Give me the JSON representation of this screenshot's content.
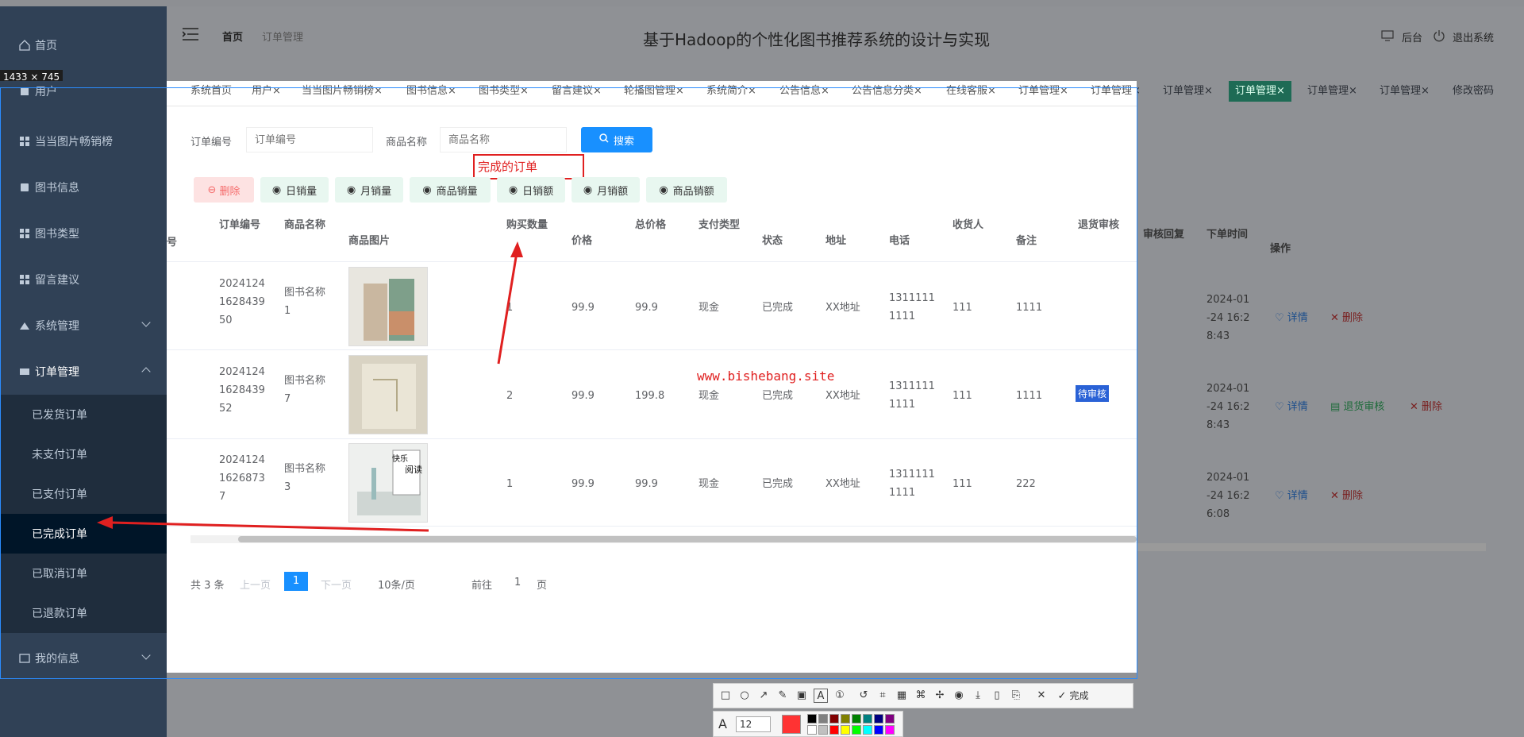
{
  "window": {
    "title": "基于Hadoop的个性化图书推荐系统的设计与实现",
    "size_label": "1433 × 745"
  },
  "header": {
    "breadcrumb": [
      "首页",
      "订单管理"
    ],
    "right_links": [
      "后台",
      "退出系统"
    ]
  },
  "tags": [
    "系统首页",
    "用户",
    "当当图片畅销榜",
    "图书信息",
    "图书类型",
    "留言建议",
    "轮播图管理",
    "系统简介",
    "公告信息",
    "公告信息分类",
    "在线客服",
    "订单管理",
    "订单管理",
    "订单管理",
    "订单管理",
    "订单管理",
    "订单管理",
    "修改密码"
  ],
  "sidebar": {
    "items": [
      {
        "label": "首页"
      },
      {
        "label": "用户"
      },
      {
        "label": "当当图片畅销榜"
      },
      {
        "label": "图书信息"
      },
      {
        "label": "图书类型"
      },
      {
        "label": "留言建议"
      },
      {
        "label": "系统管理"
      },
      {
        "label": "订单管理"
      },
      {
        "label": "我的信息"
      }
    ],
    "sub_items": [
      "已发货订单",
      "未支付订单",
      "已支付订单",
      "已完成订单",
      "已取消订单",
      "已退款订单"
    ]
  },
  "search": {
    "order_no_label": "订单编号",
    "order_no_placeholder": "订单编号",
    "product_label": "商品名称",
    "product_placeholder": "商品名称",
    "search_button": "搜索"
  },
  "annotation_text": "完成的订单",
  "watermark": "www.bishebang.site",
  "action_buttons": [
    "删除",
    "日销量",
    "月销量",
    "商品销量",
    "日销额",
    "月销额",
    "商品销额"
  ],
  "table": {
    "headers": [
      "号",
      "订单编号",
      "商品名称",
      "商品图片",
      "购买数量",
      "价格",
      "总价格",
      "支付类型",
      "状态",
      "地址",
      "电话",
      "收货人",
      "备注",
      "退货审核",
      "审核回复",
      "下单时间",
      "操作"
    ],
    "rows": [
      {
        "order_no": [
          "2024124",
          "1628439",
          "50"
        ],
        "product": [
          "图书名称",
          "1"
        ],
        "qty": "1",
        "price": "99.9",
        "total": "99.9",
        "pay": "现金",
        "status": "已完成",
        "addr": "XX地址",
        "phone": [
          "1311111",
          "1111"
        ],
        "receiver": "111",
        "remark": "1111",
        "refund": "",
        "time": [
          "2024-01",
          "-24 16:2",
          "8:43"
        ],
        "ops": [
          "详情",
          "删除"
        ]
      },
      {
        "order_no": [
          "2024124",
          "1628439",
          "52"
        ],
        "product": [
          "图书名称",
          "7"
        ],
        "qty": "2",
        "price": "99.9",
        "total": "199.8",
        "pay": "现金",
        "status": "已完成",
        "addr": "XX地址",
        "phone": [
          "1311111",
          "1111"
        ],
        "receiver": "111",
        "remark": "1111",
        "refund": "待审核",
        "time": [
          "2024-01",
          "-24 16:2",
          "8:43"
        ],
        "ops": [
          "详情",
          "退货审核",
          "删除"
        ]
      },
      {
        "order_no": [
          "2024124",
          "1626873",
          "7"
        ],
        "product": [
          "图书名称",
          "3"
        ],
        "qty": "1",
        "price": "99.9",
        "total": "99.9",
        "pay": "现金",
        "status": "已完成",
        "addr": "XX地址",
        "phone": [
          "1311111",
          "1111"
        ],
        "receiver": "111",
        "remark": "222",
        "refund": "",
        "time": [
          "2024-01",
          "-24 16:2",
          "6:08"
        ],
        "ops": [
          "详情",
          "删除"
        ]
      }
    ],
    "book3_text": [
      "快乐",
      "阅读"
    ]
  },
  "pagination": {
    "total": "共 3 条",
    "prev": "上一页",
    "current": "1",
    "next": "下一页",
    "page_size": "10条/页",
    "goto_prefix": "前往",
    "goto_value": "1",
    "goto_suffix": "页"
  },
  "screenshot_toolbar": {
    "done": "完成",
    "font_size": "12",
    "colors": [
      "#000000",
      "#808080",
      "#800000",
      "#808000",
      "#008000",
      "#008080",
      "#000080",
      "#800080",
      "#ffffff",
      "#c0c0c0",
      "#ff0000",
      "#ffff00",
      "#00ff00",
      "#00ffff",
      "#0000ff",
      "#ff00ff"
    ],
    "current_color": "#ff3333"
  }
}
